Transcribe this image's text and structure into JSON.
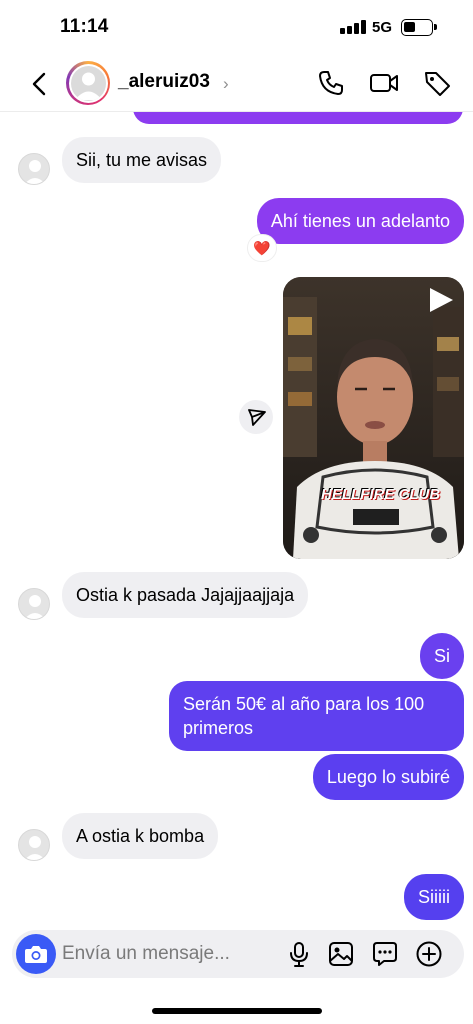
{
  "status_bar": {
    "time": "11:14",
    "network": "5G",
    "battery_level": 0.45
  },
  "header": {
    "username": "_aleruiz03",
    "chevron": "›"
  },
  "colors": {
    "accent": "#3a5af6",
    "outgoing_purple": "#8c3cf0",
    "outgoing_violet": "#5b3ff0",
    "incoming": "#efeff2"
  },
  "messages": [
    {
      "direction": "in",
      "text": "Sii, tu me avisas"
    },
    {
      "direction": "out",
      "text": "Ahí tienes un adelanto",
      "reaction": "❤️"
    },
    {
      "direction": "out",
      "type": "video",
      "overlay_text": "HELLFIRE CLUB"
    },
    {
      "direction": "in",
      "text": "Ostia k pasada Jajajjaajjaja"
    },
    {
      "direction": "out",
      "text": "Si"
    },
    {
      "direction": "out",
      "text_line1": "Serán 50€ al año para los 100",
      "text_line2": "primeros"
    },
    {
      "direction": "out",
      "text": "Luego lo subiré"
    },
    {
      "direction": "in",
      "text": "A ostia k bomba"
    },
    {
      "direction": "out",
      "text": "Siiiii"
    }
  ],
  "composer": {
    "placeholder": "Envía un mensaje..."
  },
  "icons": [
    "back-icon",
    "phone-icon",
    "video-call-icon",
    "tag-icon",
    "camera-icon",
    "microphone-icon",
    "gallery-icon",
    "sticker-icon",
    "plus-icon",
    "send-icon",
    "play-icon"
  ]
}
